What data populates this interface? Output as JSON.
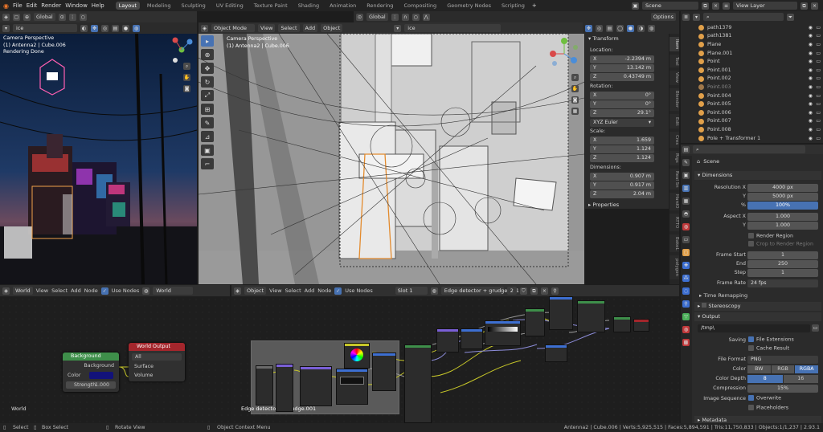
{
  "menu": [
    "File",
    "Edit",
    "Render",
    "Window",
    "Help"
  ],
  "workspaces": [
    "Layout",
    "Modeling",
    "Sculpting",
    "UV Editing",
    "Texture Paint",
    "Shading",
    "Animation",
    "Rendering",
    "Compositing",
    "Geometry Nodes",
    "Scripting"
  ],
  "active_workspace": "Layout",
  "scene_field": "Scene",
  "view_layer_field": "View Layer",
  "left_viewport": {
    "header": {
      "orientation": "Global",
      "search": "ice"
    },
    "overlay": [
      "Camera Perspective",
      "(1) Antenna2 | Cube.006",
      "Rendering Done"
    ]
  },
  "main_viewport": {
    "header": {
      "mode": "Object Mode",
      "menus": [
        "View",
        "Select",
        "Add",
        "Object"
      ],
      "orientation": "Global",
      "search": "ice"
    },
    "overlay": [
      "Camera Perspective",
      "(1) Antenna2 | Cube.006"
    ],
    "options": "Options"
  },
  "transform_panel": {
    "title": "Transform",
    "location_label": "Location:",
    "location": [
      {
        "axis": "X",
        "value": "-2.2394 m"
      },
      {
        "axis": "Y",
        "value": "13.142 m"
      },
      {
        "axis": "Z",
        "value": "0.43749 m"
      }
    ],
    "rotation_label": "Rotation:",
    "rotation": [
      {
        "axis": "X",
        "value": "0°"
      },
      {
        "axis": "Y",
        "value": "0°"
      },
      {
        "axis": "Z",
        "value": "29.1°"
      }
    ],
    "rotation_mode": "XYZ Euler",
    "scale_label": "Scale:",
    "scale": [
      {
        "axis": "X",
        "value": "1.659"
      },
      {
        "axis": "Y",
        "value": "1.124"
      },
      {
        "axis": "Z",
        "value": "1.124"
      }
    ],
    "dimensions_label": "Dimensions:",
    "dimensions": [
      {
        "axis": "X",
        "value": "0.907 m"
      },
      {
        "axis": "Y",
        "value": "0.917 m"
      },
      {
        "axis": "Z",
        "value": "2.04 m"
      }
    ],
    "properties": "Properties"
  },
  "sidebar_tabs": [
    "Item",
    "Tool",
    "View",
    "Blender",
    "Edit",
    "Cres",
    "Rigs",
    "Real Sn",
    "HardO",
    "RTTO",
    "BakeL",
    "polygon"
  ],
  "outliner": [
    {
      "name": "path1379",
      "color": "#e1a04a"
    },
    {
      "name": "path1381",
      "color": "#e1a04a"
    },
    {
      "name": "Plane",
      "color": "#e1a04a"
    },
    {
      "name": "Plane.001",
      "color": "#e1a04a"
    },
    {
      "name": "Point",
      "color": "#e1a04a"
    },
    {
      "name": "Point.001",
      "color": "#e1a04a"
    },
    {
      "name": "Point.002",
      "color": "#e1a04a"
    },
    {
      "name": "Point.003",
      "color": "#e1a04a"
    },
    {
      "name": "Point.004",
      "color": "#e1a04a"
    },
    {
      "name": "Point.005",
      "color": "#e1a04a"
    },
    {
      "name": "Point.006",
      "color": "#e1a04a"
    },
    {
      "name": "Point.007",
      "color": "#e1a04a"
    },
    {
      "name": "Point.008",
      "color": "#e1a04a"
    },
    {
      "name": "Pole + Transformer 1",
      "color": "#e1a04a"
    }
  ],
  "properties": {
    "scene": "Scene",
    "dimensions": "Dimensions",
    "resolution_x_label": "Resolution X",
    "resolution_x": "4000 px",
    "resolution_y_label": "Y",
    "resolution_y": "5000 px",
    "percent_label": "%",
    "percent": "100%",
    "aspect_x_label": "Aspect X",
    "aspect_x": "1.000",
    "aspect_y_label": "Y",
    "aspect_y": "1.000",
    "render_region": "Render Region",
    "crop_region": "Crop to Render Region",
    "frame_start_label": "Frame Start",
    "frame_start": "1",
    "end_label": "End",
    "end": "250",
    "step_label": "Step",
    "step": "1",
    "frame_rate_label": "Frame Rate",
    "frame_rate": "24 fps",
    "time_remapping": "Time Remapping",
    "stereoscopy": "Stereoscopy",
    "output": "Output",
    "output_path": "/tmp\\",
    "saving_label": "Saving",
    "file_extensions": "File Extensions",
    "cache_result": "Cache Result",
    "file_format_label": "File Format",
    "file_format": "PNG",
    "color_label": "Color",
    "color_options": [
      "BW",
      "RGB",
      "RGBA"
    ],
    "color_depth_label": "Color Depth",
    "color_depth_options": [
      "8",
      "16"
    ],
    "compression_label": "Compression",
    "compression": "15%",
    "image_sequence_label": "Image Sequence",
    "overwrite": "Overwrite",
    "placeholders": "Placeholders",
    "metadata": "Metadata"
  },
  "world_editor": {
    "header": {
      "type": "World",
      "menus": [
        "View",
        "Select",
        "Add",
        "Node"
      ],
      "use_nodes": "Use Nodes",
      "world": "World"
    },
    "background_node": {
      "title": "Background",
      "output": "Background",
      "color_label": "Color",
      "strength_label": "Strength",
      "strength": "1.000"
    },
    "world_output_node": {
      "title": "World Output",
      "target": "All",
      "surface": "Surface",
      "volume": "Volume"
    },
    "footer": "World"
  },
  "material_editor": {
    "header": {
      "type": "Object",
      "menus": [
        "View",
        "Select",
        "Add",
        "Node"
      ],
      "use_nodes": "Use Nodes",
      "slot": "Slot 1",
      "material": "Edge detector + grudge.001",
      "users": "2"
    },
    "frame_label": "Edge detector + grudge.001"
  },
  "status_bar": {
    "select": "Select",
    "box_select": "Box Select",
    "rotate_view": "Rotate View",
    "context_menu": "Object Context Menu",
    "stats": "Antenna2 | Cube.006 | Verts:5,925,515 | Faces:5,894,591 | Tris:11,750,833 | Objects:1/1,237 | 2.93.1"
  }
}
